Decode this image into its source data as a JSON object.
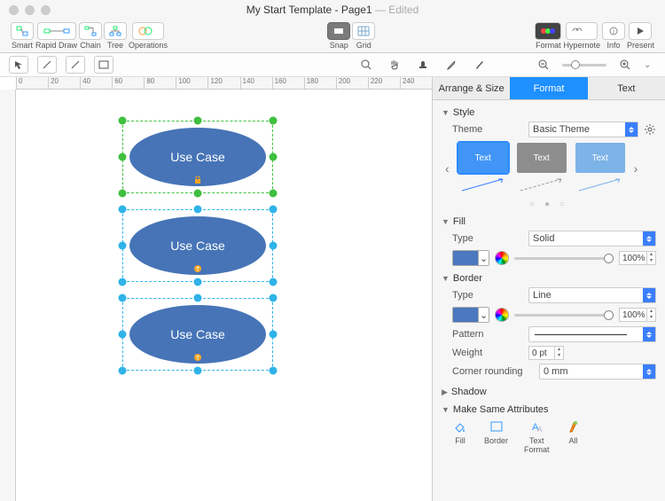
{
  "title": {
    "doc": "My Start Template - Page1",
    "status": "Edited"
  },
  "toolbar": {
    "smart": "Smart",
    "rapid": "Rapid Draw",
    "chain": "Chain",
    "tree": "Tree",
    "ops": "Operations",
    "snap": "Snap",
    "grid": "Grid",
    "format": "Format",
    "hypernote": "Hypernote",
    "info": "Info",
    "present": "Present"
  },
  "ruler": [
    "0",
    "20",
    "40",
    "60",
    "80",
    "100",
    "120",
    "140",
    "160",
    "180",
    "200",
    "220",
    "240"
  ],
  "shapes": [
    {
      "label": "Use Case",
      "color": "#3fbf3f"
    },
    {
      "label": "Use Case",
      "color": "#2fb3e8"
    },
    {
      "label": "Use Case",
      "color": "#2fb3e8"
    }
  ],
  "panel": {
    "tabs": {
      "arrange": "Arrange & Size",
      "format": "Format",
      "text": "Text"
    },
    "style": {
      "head": "Style",
      "themeLabel": "Theme",
      "themeValue": "Basic Theme",
      "cardText": "Text"
    },
    "fill": {
      "head": "Fill",
      "typeLabel": "Type",
      "typeValue": "Solid",
      "pct": "100%"
    },
    "border": {
      "head": "Border",
      "typeLabel": "Type",
      "typeValue": "Line",
      "pct": "100%",
      "patternLabel": "Pattern",
      "weightLabel": "Weight",
      "weightValue": "0 pt",
      "cornerLabel": "Corner rounding",
      "cornerValue": "0 mm"
    },
    "shadow": "Shadow",
    "same": {
      "head": "Make Same Attributes",
      "fill": "Fill",
      "border": "Border",
      "textfmt": "Text\nFormat",
      "all": "All"
    }
  }
}
